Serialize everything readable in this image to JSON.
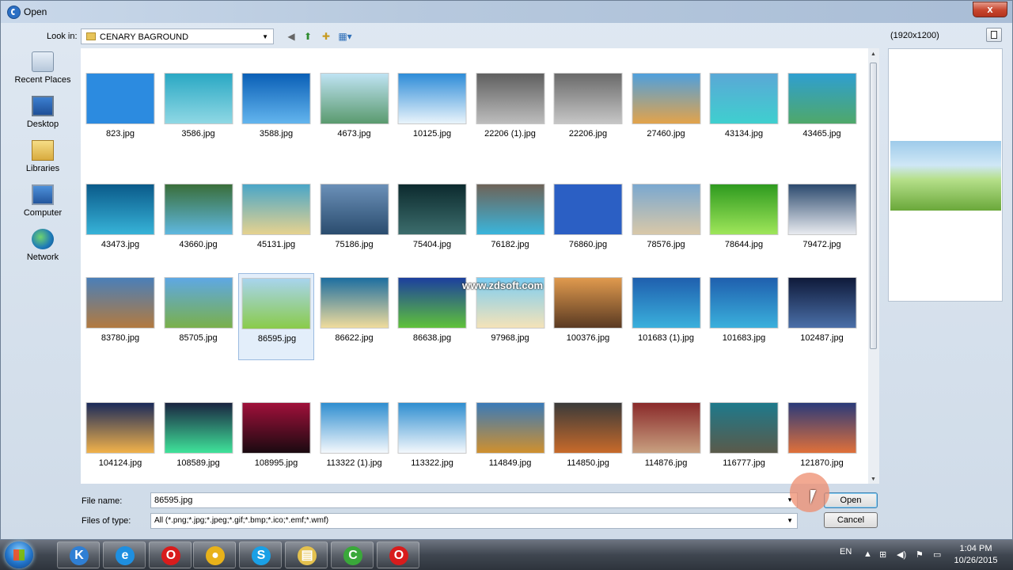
{
  "window": {
    "title": "Open",
    "close_glyph": "x"
  },
  "toolbar": {
    "look_in_label": "Look in:",
    "look_in_value": "CENARY BAGROUND"
  },
  "places": [
    {
      "label": "Recent Places",
      "icon": "recent-places-icon"
    },
    {
      "label": "Desktop",
      "icon": "desktop-icon"
    },
    {
      "label": "Libraries",
      "icon": "libraries-icon"
    },
    {
      "label": "Computer",
      "icon": "computer-icon"
    },
    {
      "label": "Network",
      "icon": "network-icon"
    }
  ],
  "files": [
    {
      "name": "823.jpg",
      "colors": [
        "#2c8be0",
        "#2c8be0"
      ]
    },
    {
      "name": "3586.jpg",
      "colors": [
        "#2aa8c4",
        "#8fd8e4"
      ]
    },
    {
      "name": "3588.jpg",
      "colors": [
        "#0a5fb6",
        "#63b5ee"
      ]
    },
    {
      "name": "4673.jpg",
      "colors": [
        "#bfe3f3",
        "#5a9a6e"
      ]
    },
    {
      "name": "10125.jpg",
      "colors": [
        "#2e8cd8",
        "#e9f4fb"
      ]
    },
    {
      "name": "22206 (1).jpg",
      "colors": [
        "#5f5f5f",
        "#bdbdbd"
      ]
    },
    {
      "name": "22206.jpg",
      "colors": [
        "#6a6a6a",
        "#c6c6c6"
      ]
    },
    {
      "name": "27460.jpg",
      "colors": [
        "#4fa0dd",
        "#e3a34a"
      ]
    },
    {
      "name": "43134.jpg",
      "colors": [
        "#5aa8d6",
        "#3fcfcf"
      ]
    },
    {
      "name": "43465.jpg",
      "colors": [
        "#2f9fd0",
        "#4fa86a"
      ]
    },
    {
      "name": "43473.jpg",
      "colors": [
        "#0a5a8a",
        "#37b3d8"
      ]
    },
    {
      "name": "43660.jpg",
      "colors": [
        "#3a6e3a",
        "#5fb8e0"
      ]
    },
    {
      "name": "45131.jpg",
      "colors": [
        "#4aa6c8",
        "#e6d28f"
      ]
    },
    {
      "name": "75186.jpg",
      "colors": [
        "#6b90b8",
        "#2a4c6e"
      ]
    },
    {
      "name": "75404.jpg",
      "colors": [
        "#0c2a2e",
        "#3c6d6c"
      ]
    },
    {
      "name": "76182.jpg",
      "colors": [
        "#6e6358",
        "#3ab5dc"
      ]
    },
    {
      "name": "76860.jpg",
      "colors": [
        "#2b5fc4",
        "#2b5fc4"
      ]
    },
    {
      "name": "78576.jpg",
      "colors": [
        "#7aa8d0",
        "#d9c8a8"
      ]
    },
    {
      "name": "78644.jpg",
      "colors": [
        "#2e9a1f",
        "#9fe65a"
      ]
    },
    {
      "name": "79472.jpg",
      "colors": [
        "#2c4a6e",
        "#e9ebf0"
      ]
    },
    {
      "name": "83780.jpg",
      "colors": [
        "#4a7fb8",
        "#b37a3f"
      ]
    },
    {
      "name": "85705.jpg",
      "colors": [
        "#5ea8e4",
        "#7ab04a"
      ]
    },
    {
      "name": "86595.jpg",
      "colors": [
        "#a8d4ee",
        "#8acb4a"
      ]
    },
    {
      "name": "86622.jpg",
      "colors": [
        "#1d6ea0",
        "#f0dc9c"
      ]
    },
    {
      "name": "86638.jpg",
      "colors": [
        "#1c3f9e",
        "#5fc23a"
      ]
    },
    {
      "name": "97968.jpg",
      "colors": [
        "#7ccdf2",
        "#f5e3b8"
      ]
    },
    {
      "name": "100376.jpg",
      "colors": [
        "#e09a4e",
        "#5a3a22"
      ]
    },
    {
      "name": "101683 (1).jpg",
      "colors": [
        "#1f5fae",
        "#3ab0dc"
      ]
    },
    {
      "name": "101683.jpg",
      "colors": [
        "#1f5fae",
        "#3ab0dc"
      ]
    },
    {
      "name": "102487.jpg",
      "colors": [
        "#0f1a3a",
        "#4a6fa8"
      ]
    },
    {
      "name": "104124.jpg",
      "colors": [
        "#1a2a5a",
        "#f2b24a"
      ]
    },
    {
      "name": "108589.jpg",
      "colors": [
        "#1a2440",
        "#3fe39a"
      ]
    },
    {
      "name": "108995.jpg",
      "colors": [
        "#a0103a",
        "#1a0a10"
      ]
    },
    {
      "name": "113322 (1).jpg",
      "colors": [
        "#2f8ed0",
        "#f4f8fc"
      ]
    },
    {
      "name": "113322.jpg",
      "colors": [
        "#2f8ed0",
        "#f4f8fc"
      ]
    },
    {
      "name": "114849.jpg",
      "colors": [
        "#3a7ab8",
        "#d0902e"
      ]
    },
    {
      "name": "114850.jpg",
      "colors": [
        "#3a3a3a",
        "#c86a2a"
      ]
    },
    {
      "name": "114876.jpg",
      "colors": [
        "#8a2a2a",
        "#c8a080"
      ]
    },
    {
      "name": "116777.jpg",
      "colors": [
        "#1e7a8c",
        "#5a5a4a"
      ]
    },
    {
      "name": "121870.jpg",
      "colors": [
        "#2a3a7a",
        "#e0703a"
      ]
    }
  ],
  "selected_file": "86595.jpg",
  "preview": {
    "label": "(1920x1200)"
  },
  "watermark": "www.zdsoft.com",
  "bottom": {
    "file_name_label": "File name:",
    "file_name_value": "86595.jpg",
    "file_type_label": "Files of type:",
    "file_type_value": "All (*.png;*.jpg;*.jpeg;*.gif;*.bmp;*.ico;*.emf;*.wmf)",
    "open_label": "Open",
    "cancel_label": "Cancel"
  },
  "taskbar": {
    "apps": [
      {
        "icon": "app-k-icon",
        "glyph": "K",
        "color": "#2f7fd4"
      },
      {
        "icon": "internet-explorer-icon",
        "glyph": "e",
        "color": "#1e8fe0"
      },
      {
        "icon": "opera-icon",
        "glyph": "O",
        "color": "#d81c1c"
      },
      {
        "icon": "chrome-icon",
        "glyph": "●",
        "color": "#e8b21a"
      },
      {
        "icon": "skype-icon",
        "glyph": "S",
        "color": "#1aa0e6"
      },
      {
        "icon": "file-explorer-icon",
        "glyph": "▤",
        "color": "#e4c14e"
      },
      {
        "icon": "camtasia-icon",
        "glyph": "C",
        "color": "#3aa83a"
      },
      {
        "icon": "opera-icon-2",
        "glyph": "O",
        "color": "#d81c1c"
      }
    ],
    "language": "EN",
    "time": "1:04 PM",
    "date": "10/26/2015"
  }
}
